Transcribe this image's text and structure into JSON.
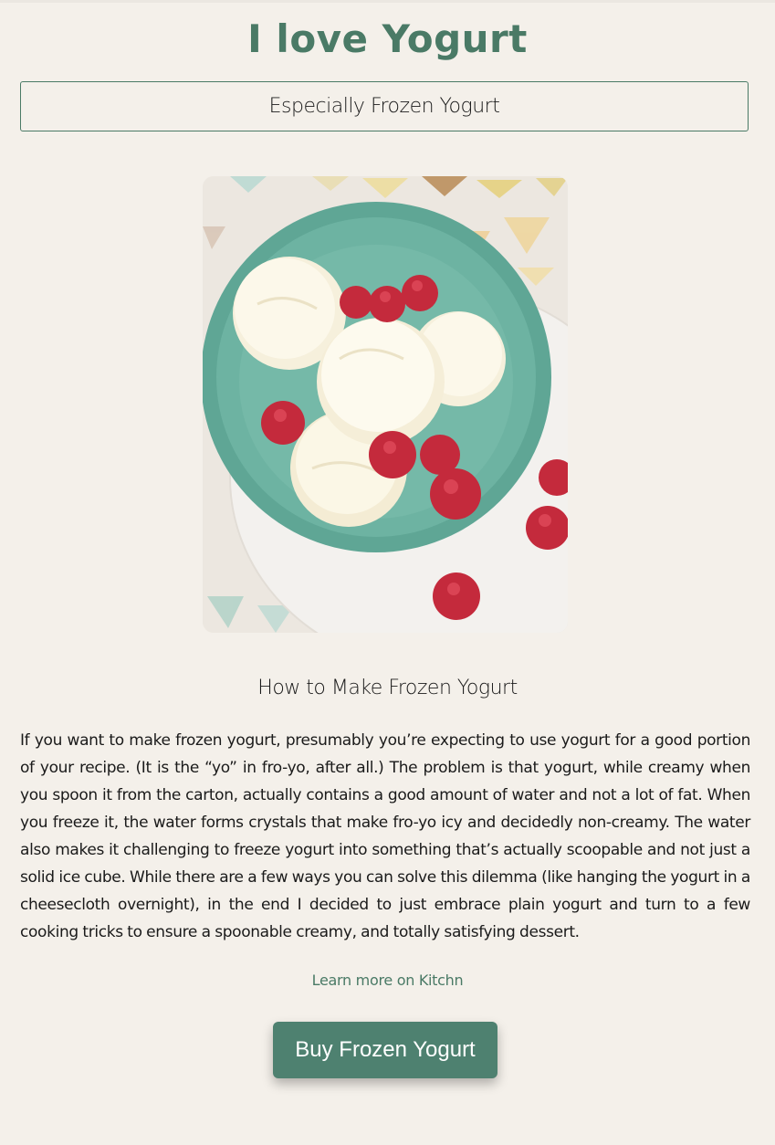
{
  "page": {
    "title": "I love Yogurt",
    "subtitle": "Especially Frozen Yogurt"
  },
  "hero_image": {
    "description": "Bowl of frozen yogurt scoops with raspberries",
    "colors": {
      "background": "#ece7e0",
      "bowl": "#6db3a2",
      "plate": "#f3f1ee",
      "yogurt": "#fbf7e6",
      "raspberry": "#c42a3c"
    }
  },
  "article": {
    "heading": "How to Make Frozen Yogurt",
    "body": "If you want to make frozen yogurt, presumably you’re expecting to use yogurt for a good portion of your recipe. (It is the “yo” in fro-yo, after all.) The problem is that yogurt, while creamy when you spoon it from the carton, actually contains a good amount of water and not a lot of fat. When you freeze it, the water forms crystals that make fro-yo icy and decidedly non-creamy. The water also makes it challenging to freeze yogurt into something that’s actually scoopable and not just a solid ice cube. While there are a few ways you can solve this dilemma (like hanging the yogurt in a cheesecloth overnight), in the end I decided to just embrace plain yogurt and turn to a few cooking tricks to ensure a spoonable creamy, and totally satisfying dessert.",
    "link_label": "Learn more on Kitchn"
  },
  "cta": {
    "label": "Buy Frozen Yogurt"
  },
  "colors": {
    "background": "#f4f0ea",
    "accent": "#4a7a66",
    "button": "#4e8170",
    "text": "#1a1a1a"
  }
}
